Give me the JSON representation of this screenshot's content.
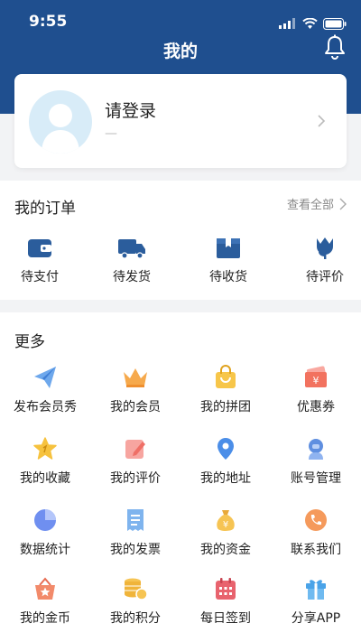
{
  "status_bar": {
    "time": "9:55"
  },
  "nav": {
    "title": "我的"
  },
  "profile": {
    "login_label": "请登录",
    "subtitle": "—"
  },
  "orders": {
    "title": "我的订单",
    "view_all": "查看全部",
    "items": [
      {
        "label": "待支付",
        "icon": "wallet-icon"
      },
      {
        "label": "待发货",
        "icon": "truck-icon"
      },
      {
        "label": "待收货",
        "icon": "box-icon"
      },
      {
        "label": "待评价",
        "icon": "tulip-icon"
      }
    ]
  },
  "more": {
    "title": "更多",
    "items": [
      {
        "label": "发布会员秀",
        "icon": "paper-plane-icon"
      },
      {
        "label": "我的会员",
        "icon": "crown-icon"
      },
      {
        "label": "我的拼团",
        "icon": "shopping-bag-icon"
      },
      {
        "label": "优惠券",
        "icon": "coupon-icon"
      },
      {
        "label": "我的收藏",
        "icon": "star-icon"
      },
      {
        "label": "我的评价",
        "icon": "edit-icon"
      },
      {
        "label": "我的地址",
        "icon": "location-pin-icon"
      },
      {
        "label": "账号管理",
        "icon": "user-icon"
      },
      {
        "label": "数据统计",
        "icon": "pie-chart-icon"
      },
      {
        "label": "我的发票",
        "icon": "invoice-icon"
      },
      {
        "label": "我的资金",
        "icon": "money-bag-icon"
      },
      {
        "label": "联系我们",
        "icon": "phone-icon"
      },
      {
        "label": "我的金币",
        "icon": "basket-star-icon"
      },
      {
        "label": "我的积分",
        "icon": "coins-icon"
      },
      {
        "label": "每日签到",
        "icon": "calendar-icon"
      },
      {
        "label": "分享APP",
        "icon": "gift-icon"
      }
    ]
  },
  "colors": {
    "header": "#1f4f8f",
    "icon_blue": "#2b5d9c",
    "background": "#f2f3f5"
  }
}
